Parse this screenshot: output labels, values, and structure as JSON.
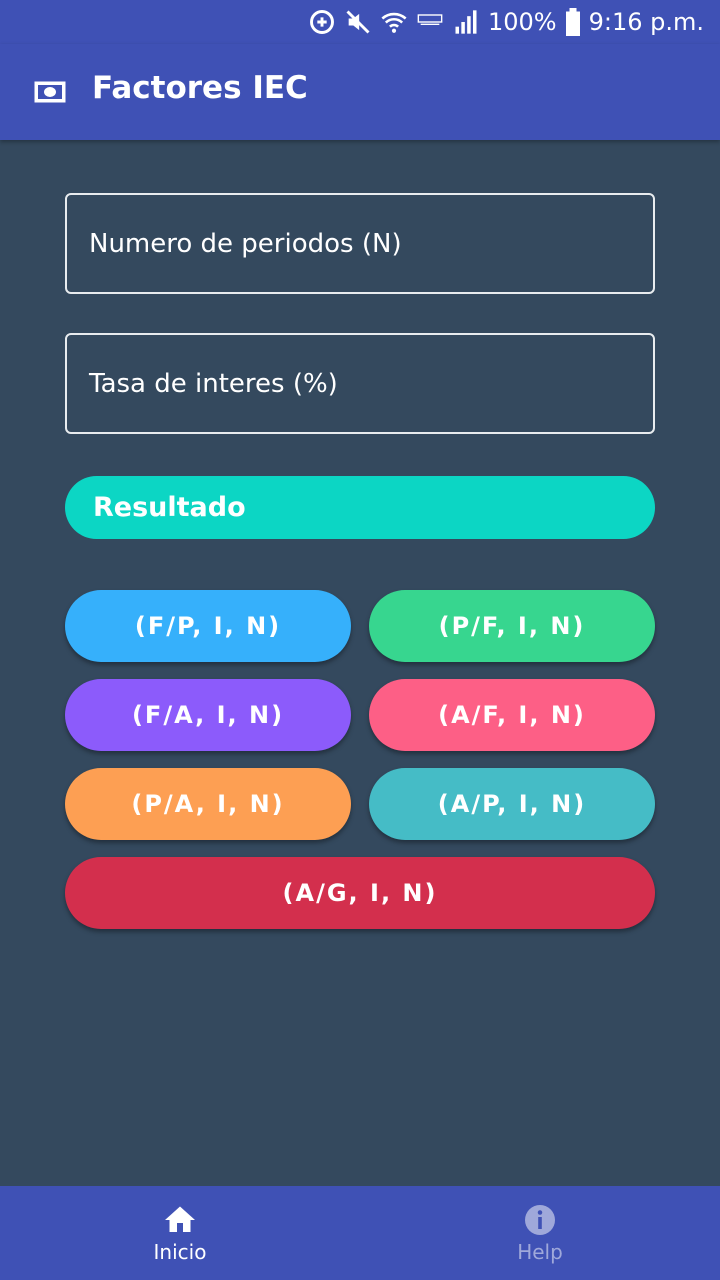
{
  "status_bar": {
    "battery": "100%",
    "time": "9:16 p.m.",
    "icons": [
      "data-saver-icon",
      "mute-icon",
      "wifi-icon",
      "lte-icon",
      "signal-icon",
      "battery-icon"
    ]
  },
  "app_bar": {
    "title": "Factores IEC",
    "icon": "money-icon"
  },
  "form": {
    "periods_placeholder": "Numero de periodos (N)",
    "rate_placeholder": "Tasa de interes (%)",
    "result_label": "Resultado"
  },
  "factors": [
    {
      "label": "(F/P, I, N)",
      "color": "#36b0fb"
    },
    {
      "label": "(P/F, I, N)",
      "color": "#37d68f"
    },
    {
      "label": "(F/A, I, N)",
      "color": "#8c5bfb"
    },
    {
      "label": "(A/F, I, N)",
      "color": "#fd5f86"
    },
    {
      "label": "(P/A, I, N)",
      "color": "#fd9f53"
    },
    {
      "label": "(A/P, I, N)",
      "color": "#45bcc6"
    },
    {
      "label": "(A/G, I, N)",
      "color": "#d32f4d"
    }
  ],
  "bottom_nav": {
    "items": [
      {
        "label": "Inicio",
        "icon": "home-icon",
        "active": true
      },
      {
        "label": "Help",
        "icon": "info-icon",
        "active": false
      }
    ]
  },
  "colors": {
    "primary": "#3f51b5",
    "background": "#34495e",
    "result": "#0cd6c4"
  }
}
